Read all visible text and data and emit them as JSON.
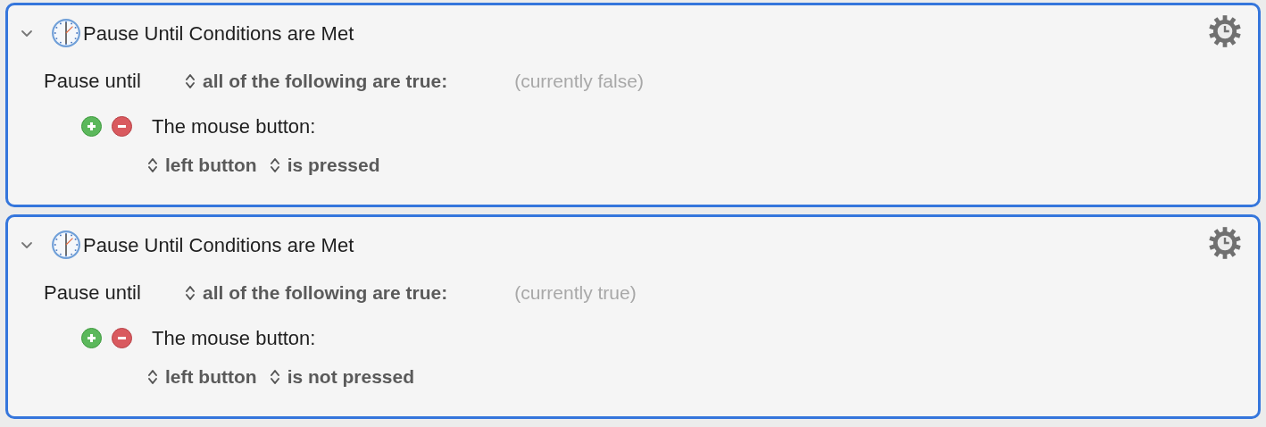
{
  "actions": [
    {
      "title": "Pause Until Conditions are Met",
      "expanded": true,
      "label": "Pause until",
      "mode": "all of the following are true:",
      "status": "(currently false)",
      "conditions": [
        {
          "label": "The mouse button:",
          "button": "left button",
          "state": "is pressed"
        }
      ]
    },
    {
      "title": "Pause Until Conditions are Met",
      "expanded": true,
      "label": "Pause until",
      "mode": "all of the following are true:",
      "status": "(currently true)",
      "conditions": [
        {
          "label": "The mouse button:",
          "button": "left button",
          "state": "is not pressed"
        }
      ]
    }
  ]
}
